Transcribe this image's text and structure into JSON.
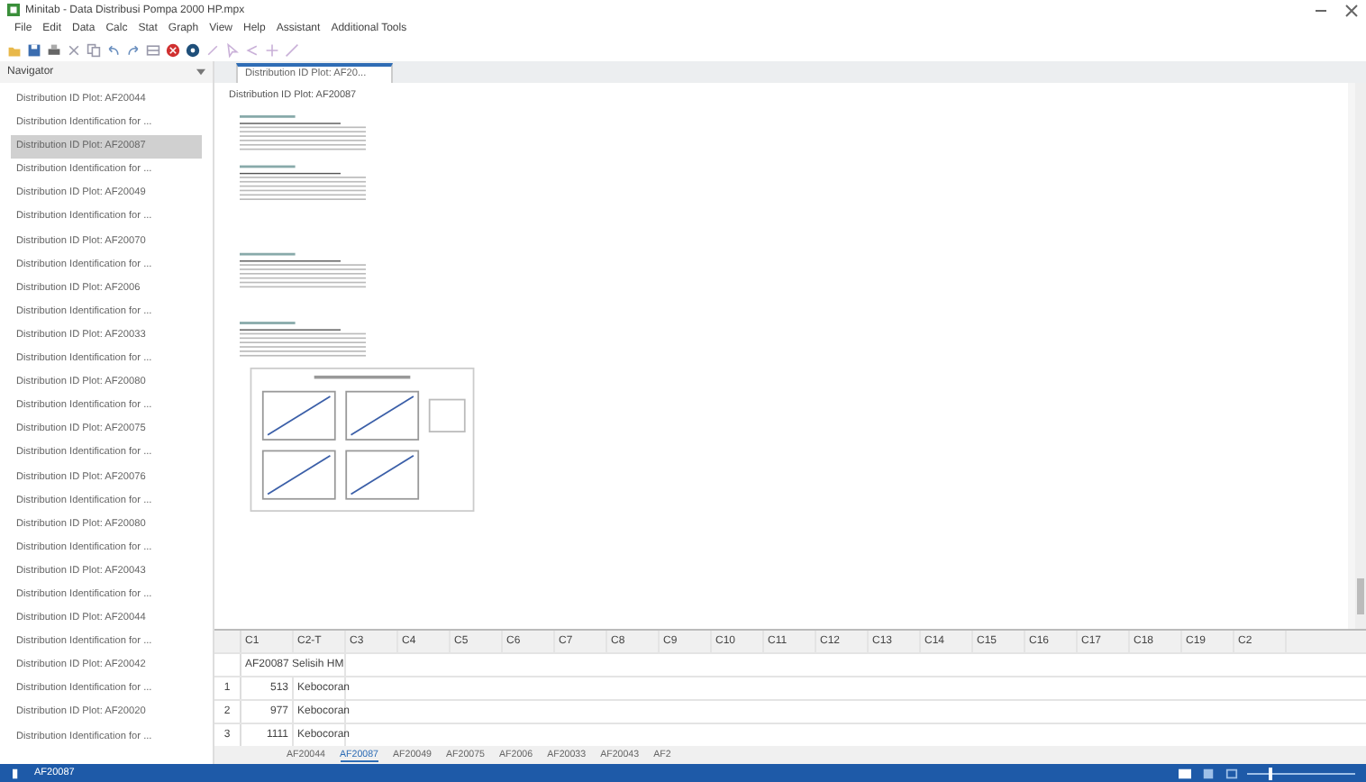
{
  "window": {
    "title": "Minitab - Data Distribusi Pompa 2000 HP.mpx"
  },
  "menu": [
    "File",
    "Edit",
    "Data",
    "Calc",
    "Stat",
    "Graph",
    "View",
    "Help",
    "Assistant",
    "Additional Tools"
  ],
  "navigator": {
    "title": "Navigator",
    "items": [
      {
        "label": "Distribution ID Plot: AF20044",
        "selected": false
      },
      {
        "label": "Distribution Identification for ...",
        "selected": false
      },
      {
        "label": "Distribution ID Plot: AF20087",
        "selected": true
      },
      {
        "label": "Distribution Identification for ...",
        "selected": false
      },
      {
        "label": "Distribution ID Plot: AF20049",
        "selected": false
      },
      {
        "label": "Distribution Identification for ...",
        "selected": false
      },
      {
        "label": "Distribution ID Plot: AF20070",
        "selected": false
      },
      {
        "label": "Distribution Identification for ...",
        "selected": false
      },
      {
        "label": "Distribution ID Plot: AF2006",
        "selected": false
      },
      {
        "label": "Distribution Identification for ...",
        "selected": false
      },
      {
        "label": "Distribution ID Plot: AF20033",
        "selected": false
      },
      {
        "label": "Distribution Identification for ...",
        "selected": false
      },
      {
        "label": "Distribution ID Plot: AF20080",
        "selected": false
      },
      {
        "label": "Distribution Identification for ...",
        "selected": false
      },
      {
        "label": "Distribution ID Plot: AF20075",
        "selected": false
      },
      {
        "label": "Distribution Identification for ...",
        "selected": false
      },
      {
        "label": "Distribution ID Plot: AF20076",
        "selected": false
      },
      {
        "label": "Distribution Identification for ...",
        "selected": false
      },
      {
        "label": "Distribution ID Plot: AF20080",
        "selected": false
      },
      {
        "label": "Distribution Identification for ...",
        "selected": false
      },
      {
        "label": "Distribution ID Plot: AF20043",
        "selected": false
      },
      {
        "label": "Distribution Identification for ...",
        "selected": false
      },
      {
        "label": "Distribution ID Plot: AF20044",
        "selected": false
      },
      {
        "label": "Distribution Identification for ...",
        "selected": false
      },
      {
        "label": "Distribution ID Plot: AF20042",
        "selected": false
      },
      {
        "label": "Distribution Identification for ...",
        "selected": false
      },
      {
        "label": "Distribution ID Plot: AF20020",
        "selected": false
      },
      {
        "label": "Distribution Identification for ...",
        "selected": false
      }
    ]
  },
  "output_tab": {
    "label": "Distribution ID Plot: AF20...",
    "selected": true
  },
  "report": {
    "subtitle": "Distribution ID Plot: AF20087"
  },
  "worksheet": {
    "columns": [
      "C1",
      "C2-T",
      "C3",
      "C4",
      "C5",
      "C6",
      "C7",
      "C8",
      "C9",
      "C10",
      "C11",
      "C12",
      "C13",
      "C14",
      "C15",
      "C16",
      "C17",
      "C18",
      "C19",
      "C2"
    ],
    "names": [
      "AF20087 Selisih HM"
    ],
    "rows": [
      {
        "number": "1",
        "value": "513",
        "text": "Kebocoran"
      },
      {
        "number": "2",
        "value": "977",
        "text": "Kebocoran"
      },
      {
        "number": "3",
        "value": "1111",
        "text": "Kebocoran"
      }
    ]
  },
  "sheet_tabs": [
    {
      "label": "AF20044",
      "selected": false
    },
    {
      "label": "AF20087",
      "selected": true
    },
    {
      "label": "AF20049",
      "selected": false
    },
    {
      "label": "AF20075",
      "selected": false
    },
    {
      "label": "AF2006",
      "selected": false
    },
    {
      "label": "AF20033",
      "selected": false
    },
    {
      "label": "AF20043",
      "selected": false
    },
    {
      "label": "AF2",
      "selected": false
    }
  ],
  "status_bar": {
    "label": "AF20087",
    "zoom": {
      "level": 0.2
    }
  }
}
